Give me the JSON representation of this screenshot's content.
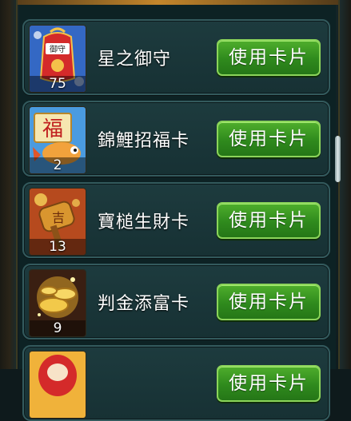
{
  "cards": [
    {
      "name": "星之御守",
      "quantity": "75",
      "button_label": "使用卡片",
      "icon": "omamori-charm-icon",
      "thumb_label": "御守"
    },
    {
      "name": "錦鯉招福卡",
      "quantity": "2",
      "button_label": "使用卡片",
      "icon": "koi-fortune-icon",
      "thumb_label": "福"
    },
    {
      "name": "寶槌生財卡",
      "quantity": "13",
      "button_label": "使用卡片",
      "icon": "treasure-mallet-icon",
      "thumb_label": "吉"
    },
    {
      "name": "判金添富卡",
      "quantity": "9",
      "button_label": "使用卡片",
      "icon": "gold-coins-icon"
    },
    {
      "name": "",
      "quantity": "",
      "button_label": "使用卡片",
      "icon": "daruma-icon"
    }
  ],
  "colors": {
    "button_green": "#2f8a1d",
    "card_bg": "#1d3b3e",
    "card_border": "#335a5d"
  }
}
